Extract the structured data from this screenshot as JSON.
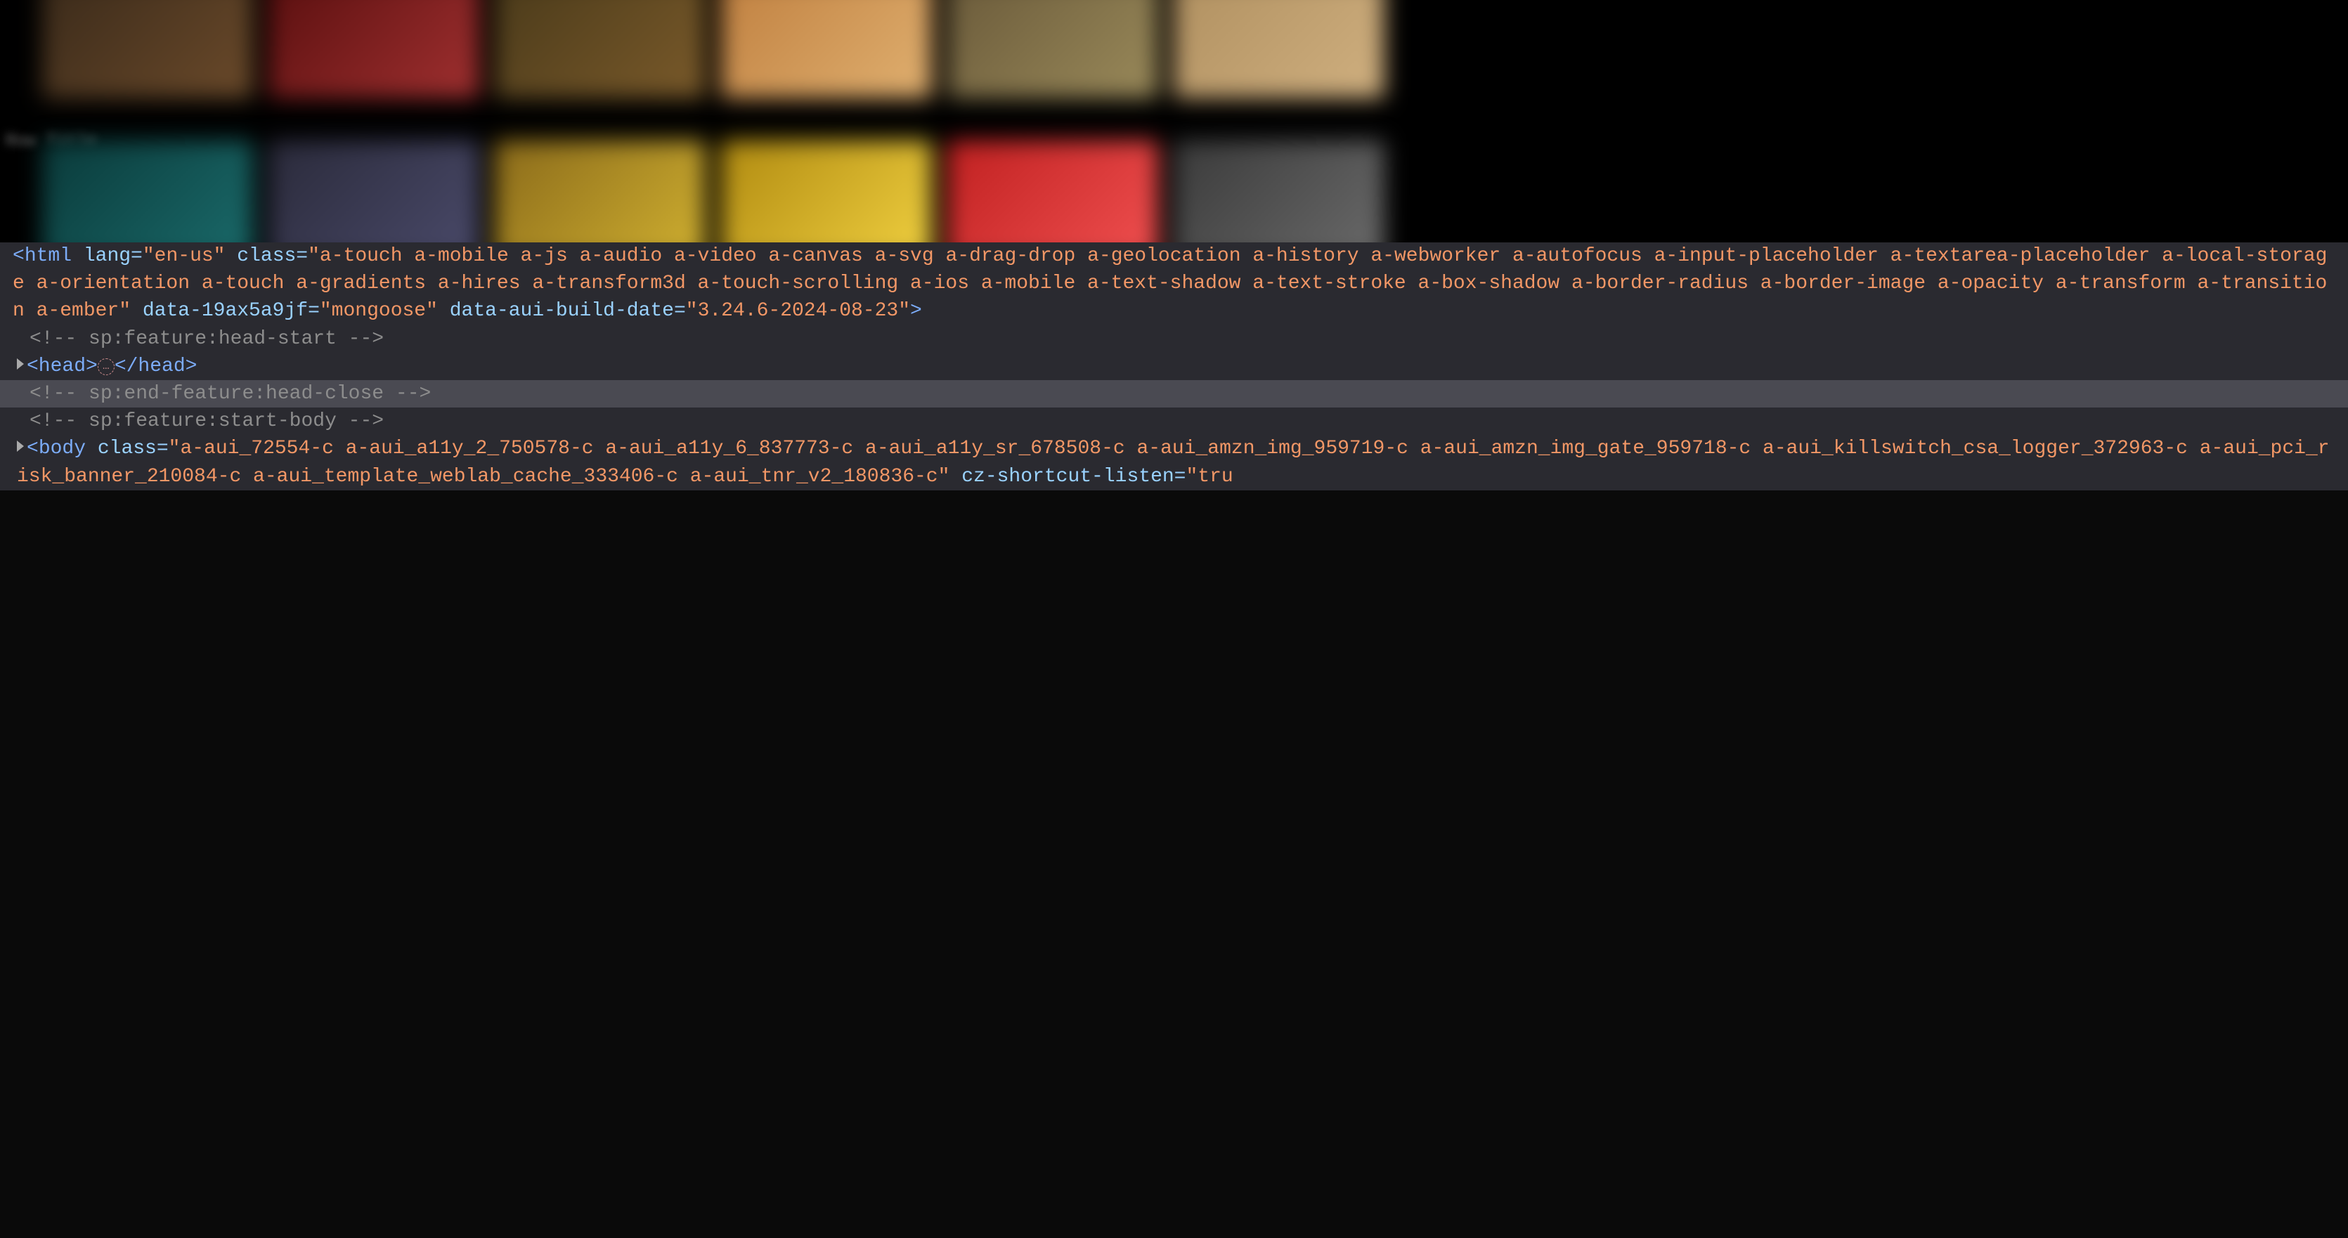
{
  "row_label": "Row Title",
  "thumbs_top": [
    "linear-gradient(135deg,#3a2a1a,#6b4a2a)",
    "linear-gradient(135deg,#5a0f0f,#a03030)",
    "linear-gradient(135deg,#4a3a1a,#7a5a2a)",
    "linear-gradient(135deg,#c08040,#e0b070)",
    "linear-gradient(135deg,#6a5a3a,#9a8a5a)",
    "linear-gradient(135deg,#b09060,#d0b080)"
  ],
  "thumbs_bottom": [
    "linear-gradient(135deg,#0a3a3a,#1a6a6a)",
    "linear-gradient(135deg,#2a2a3a,#4a4a6a)",
    "linear-gradient(135deg,#8a6a1a,#d0b030)",
    "linear-gradient(135deg,#b08a10,#f0d040)",
    "linear-gradient(135deg,#c02020,#f05050)",
    "linear-gradient(135deg,#3a3a3a,#6a6a6a)"
  ],
  "code": {
    "html_open_bracket": "<",
    "html_tag": "html",
    "lang_attr": " lang=",
    "lang_val": "\"en-us\"",
    "class_attr": " class=",
    "html_class_val": "\"a-touch a-mobile a-js a-audio a-video a-canvas a-svg a-drag-drop a-geolocation a-history a-webworker a-autofocus a-input-placeholder a-textarea-placeholder a-local-storage a-orientation a-touch a-gradients a-hires a-transform3d a-touch-scrolling a-ios a-mobile a-text-shadow a-text-stroke a-box-shadow a-border-radius a-border-image a-opacity a-transform a-transition a-ember\"",
    "data19_attr": " data-19ax5a9jf=",
    "data19_val": "\"mongoose\"",
    "build_attr": " data-aui-build-date=",
    "build_val": "\"3.24.6-2024-08-23\"",
    "close_bracket": ">",
    "comment_head_start": "<!-- sp:feature:head-start -->",
    "head_open": "<head>",
    "head_close": "</head>",
    "comment_head_close": "<!-- sp:end-feature:head-close -->",
    "comment_body_start": "<!-- sp:feature:start-body -->",
    "body_tag": "body",
    "body_class_val": "\"a-aui_72554-c a-aui_a11y_2_750578-c a-aui_a11y_6_837773-c a-aui_a11y_sr_678508-c a-aui_amzn_img_959719-c a-aui_amzn_img_gate_959718-c a-aui_killswitch_csa_logger_372963-c a-aui_pci_risk_banner_210084-c a-aui_template_weblab_cache_333406-c a-aui_tnr_v2_180836-c\"",
    "cz_attr": " cz-shortcut-listen=",
    "cz_val": "\"tru"
  }
}
